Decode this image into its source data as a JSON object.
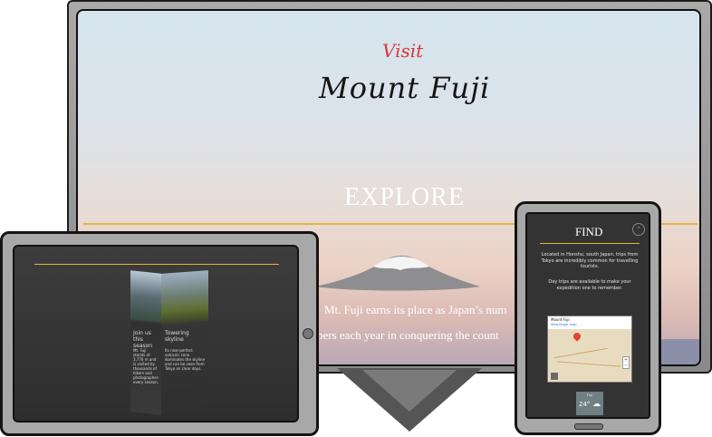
{
  "monitor": {
    "visit_label": "Visit",
    "site_title": "Mount Fuji",
    "section_heading": "EXPLORE",
    "hero_line_1": "Mt. Fuji earns its place as Japan’s num",
    "hero_line_2": "bers each year in conquering the count"
  },
  "tablet": {
    "col1_heading": "Join us this season",
    "col2_heading": "Towering skyline",
    "col1_text": "Mt. Fuji stands at 3,776 m and is visited by thousands of hikers and photographers every season.",
    "col2_text": "Its near-perfect volcanic cone dominates the skyline and can be seen from Tokyo on clear days."
  },
  "phone": {
    "section_heading": "FIND",
    "paragraph_1": "Located in Honshu, south Japan, trips from Tokyo are incredibly common for travelling tourists.",
    "paragraph_2": "Day trips are available to make your expedition one to remember.",
    "map_place_name": "Mount Fuji",
    "map_link_text": "View larger map",
    "weather_label": "Fuji",
    "weather_temp": "24°"
  },
  "colors": {
    "accent_gold": "#e5b53b",
    "visit_red": "#d9383c"
  }
}
